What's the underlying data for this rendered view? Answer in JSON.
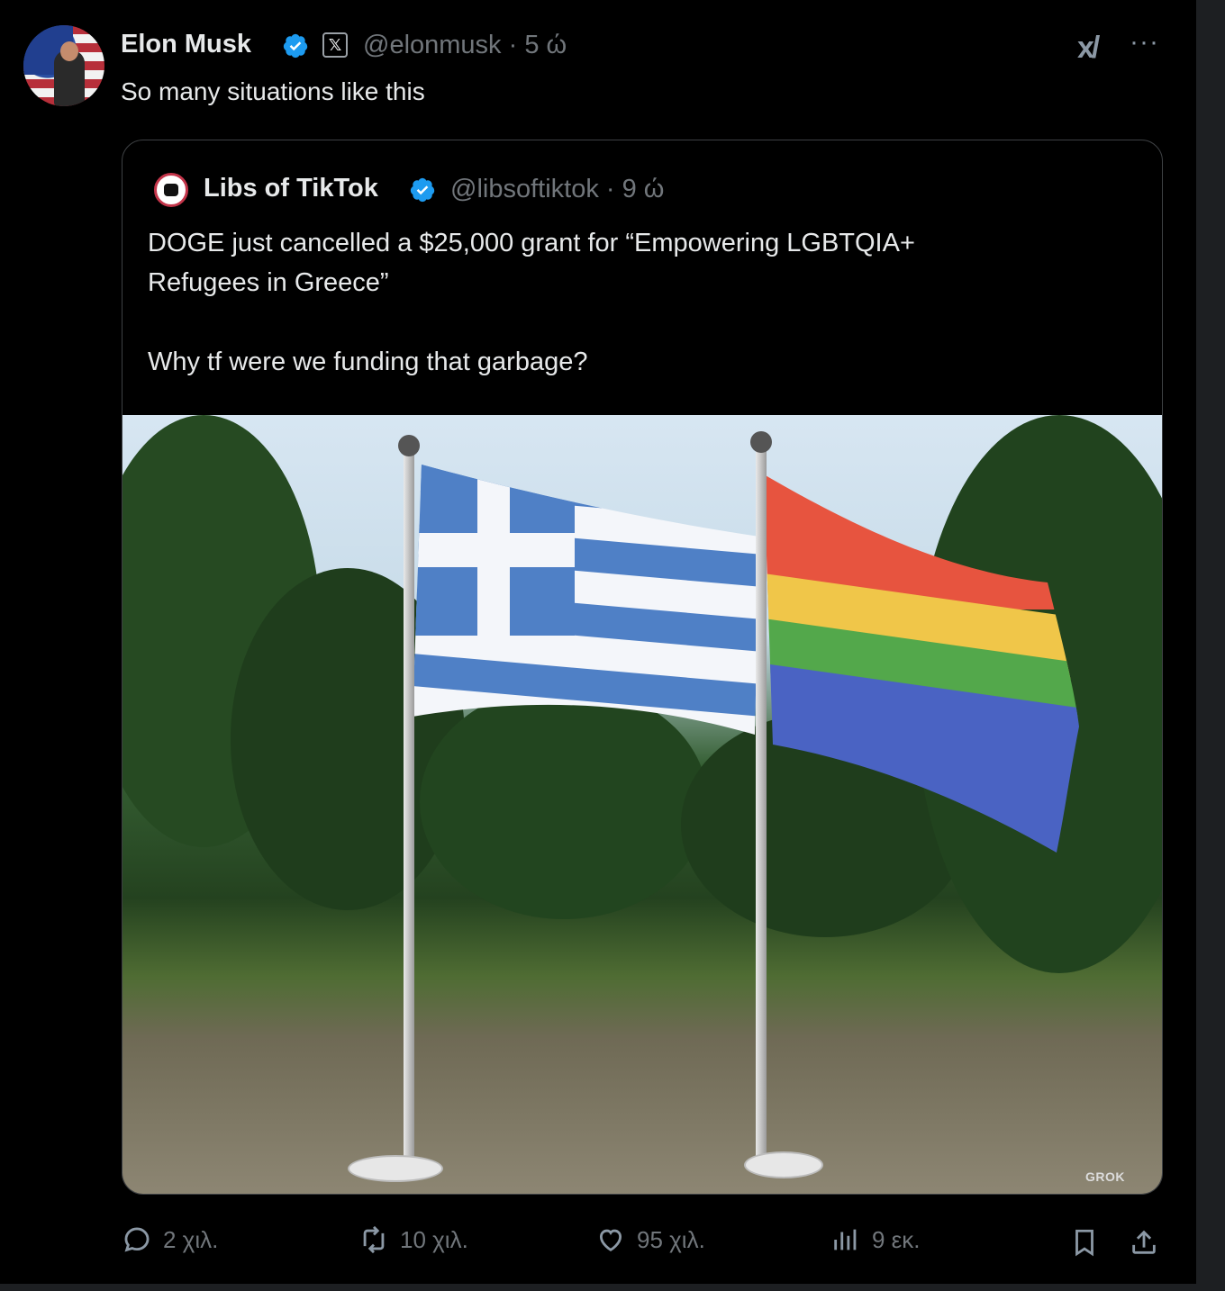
{
  "author": {
    "name": "Elon Musk",
    "handle_line": "@elonmusk · 5 ώ",
    "badge_icon": "x-logo-badge"
  },
  "tweet": {
    "text": "So many situations like this"
  },
  "quoted": {
    "name": "Libs of TikTok",
    "handle_line": "@libsoftiktok · 9 ώ",
    "text_line1": "DOGE just cancelled a $25,000 grant for “Empowering LGBTQIA+",
    "text_line2": "Refugees in Greece”",
    "text_line3": "Why tf were we funding that garbage?",
    "media_watermark": "GROK",
    "media_description": "Greek flag and rainbow flag side by side in a park"
  },
  "actions": {
    "replies": "2 χιλ.",
    "reposts": "10 χιλ.",
    "likes": "95 χιλ.",
    "views": "9 εκ."
  },
  "colors": {
    "background": "#000000",
    "text": "#e7e9ea",
    "muted": "#71767b",
    "verified": "#1d9bf0"
  }
}
